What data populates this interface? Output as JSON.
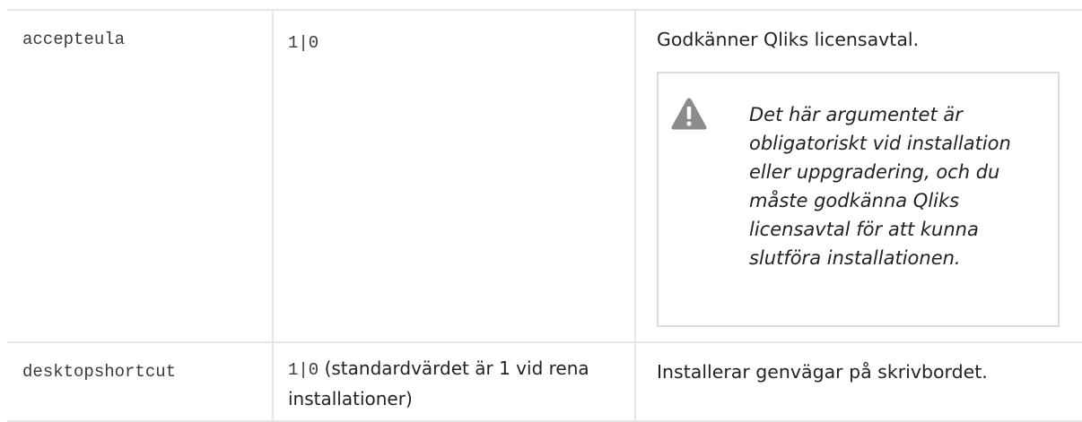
{
  "rows": [
    {
      "argument": "accepteula",
      "values_mono": "1|0",
      "values_text": "",
      "description": "Godkänner Qliks licensavtal.",
      "note": {
        "icon": "warning-icon",
        "text": "Det här argumentet är obligatoriskt vid installation eller uppgradering, och du måste godkänna Qliks licensavtal för att kunna slutföra installationen."
      }
    },
    {
      "argument": "desktopshortcut",
      "values_mono": "1|0",
      "values_text": " (standardvärdet är 1 vid rena installationer)",
      "description": "Installerar genvägar på skrivbordet."
    }
  ],
  "colors": {
    "border": "#e6e6e6",
    "note_border": "#dcdcdc",
    "warning_icon": "#8c8c8c"
  }
}
